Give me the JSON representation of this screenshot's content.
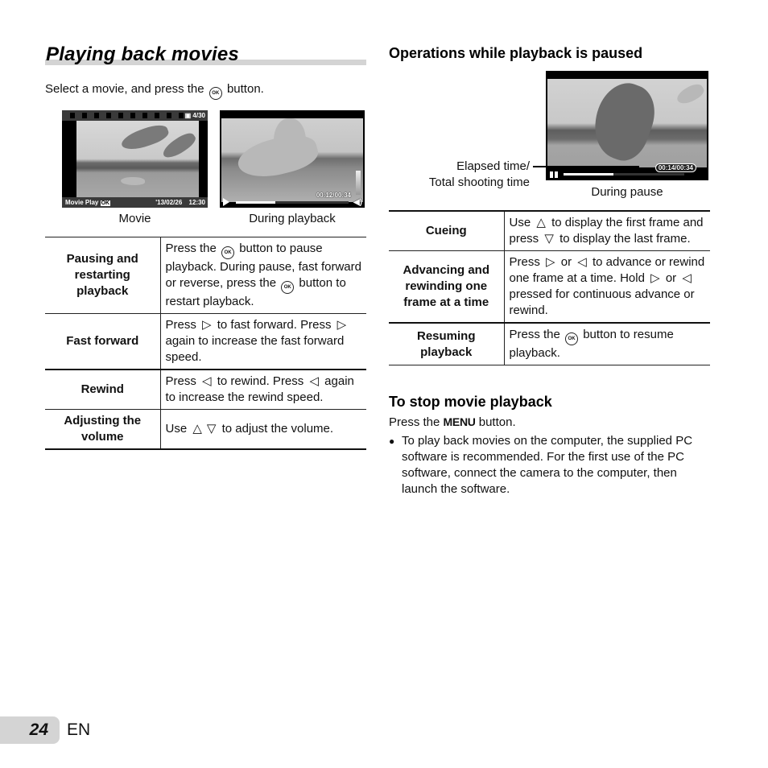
{
  "page": {
    "title": "Playing back movies",
    "intro_before": "Select a movie, and press the",
    "intro_after": "button.",
    "ok_label": "OK",
    "page_number": "24",
    "language": "EN"
  },
  "screens": {
    "movie": {
      "caption": "Movie",
      "frame_count": "4/30",
      "mode_label": "Movie Play",
      "ok_label": "OK",
      "date": "'13/02/26",
      "time": "12:30"
    },
    "during_playback": {
      "caption": "During playback",
      "timecode": "00:12/00:34",
      "progress_fraction": 0.35
    },
    "during_pause": {
      "caption": "During pause",
      "timecode": "00:14/00:34",
      "progress_fraction": 0.41,
      "callout_line1": "Elapsed time/",
      "callout_line2": "Total shooting time"
    }
  },
  "playback_table": {
    "rows": [
      {
        "label": "Pausing and restarting playback",
        "text_parts": [
          "Press the",
          "button to pause playback. During pause, fast forward or reverse, press the",
          "button to restart playback."
        ]
      },
      {
        "label": "Fast forward",
        "text_parts": [
          "Press",
          "to fast forward. Press",
          "again to increase the fast forward speed."
        ]
      },
      {
        "label": "Rewind",
        "text_parts": [
          "Press",
          "to rewind. Press",
          "again to increase the rewind speed."
        ]
      },
      {
        "label": "Adjusting the volume",
        "text_parts": [
          "Use",
          "to adjust the volume."
        ]
      }
    ]
  },
  "paused_section": {
    "heading": "Operations while playback is paused",
    "rows": [
      {
        "label": "Cueing",
        "text_parts": [
          "Use",
          "to display the first frame and press",
          "to display the last frame."
        ]
      },
      {
        "label": "Advancing and rewinding one frame at a time",
        "text_parts": [
          "Press",
          "or",
          "to advance or rewind one frame at a time. Hold",
          "or",
          "pressed for continuous advance or rewind."
        ]
      },
      {
        "label": "Resuming playback",
        "text_parts": [
          "Press the",
          "button to resume playback."
        ]
      }
    ]
  },
  "stop_section": {
    "heading": "To stop movie playback",
    "press_before": "Press the",
    "menu_word": "MENU",
    "press_after": "button.",
    "bullet": "To play back movies on the computer, the supplied PC software is recommended. For the first use of the PC software, connect the camera to the computer, then launch the software."
  },
  "icons": {
    "up": "△",
    "down": "▽",
    "right": "▷",
    "left": "◁",
    "bullet": "●"
  }
}
